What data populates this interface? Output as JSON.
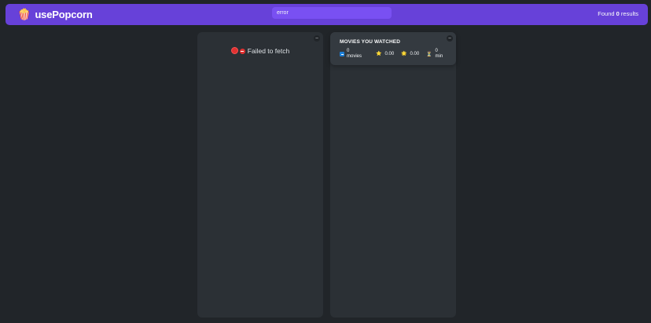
{
  "nav": {
    "logo_icon": "🍿",
    "logo_text": "usePopcorn",
    "search_value": "error",
    "results_prefix": "Found",
    "results_count": "0",
    "results_suffix": "results"
  },
  "list_box": {
    "toggle_label": "–",
    "error_message": "Failed to fetch",
    "error_icon": "⛔"
  },
  "watched_box": {
    "toggle_label": "–",
    "summary_title": "MOVIES YOU WATCHED",
    "movies_count": "0",
    "movies_label": "movies",
    "imdb_icon": "⭐",
    "imdb_rating": "0.00",
    "user_icon": "🌟",
    "user_rating": "0.00",
    "runtime_icon": "⏳",
    "runtime_value": "0",
    "runtime_unit": "min"
  },
  "colors": {
    "background": "#212529",
    "nav": "#6741d9",
    "search": "#7950f2",
    "box": "#2b3035",
    "summary": "#343a40"
  }
}
